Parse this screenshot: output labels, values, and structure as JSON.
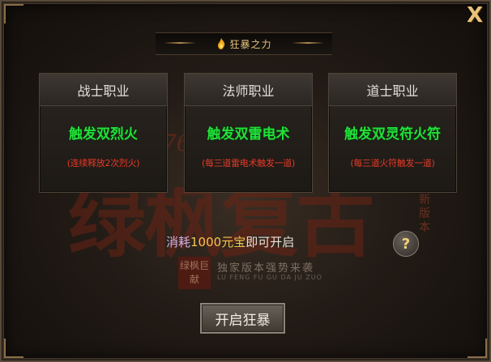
{
  "title": "狂暴之力",
  "close_label": "X",
  "cards": [
    {
      "class_name": "战士职业",
      "effect": "触发双烈火",
      "note": "(连续释放2次烈火)"
    },
    {
      "class_name": "法师职业",
      "effect": "触发双雷电术",
      "note": "(每三道雷电术触发一道)"
    },
    {
      "class_name": "道士职业",
      "effect": "触发双灵符火符",
      "note": "(每三道火符触发一道)"
    }
  ],
  "cost": {
    "prefix": "消耗",
    "amount": "1000元宝",
    "suffix": "即可开启"
  },
  "help_label": "?",
  "start_button": "开启狂暴",
  "watermark": {
    "big_text": "绿枫复古",
    "number": "176",
    "seal": "绿枫巨献",
    "tagline": "独家版本强势来袭",
    "pinyin": "LU FENG FU GU DA JU ZUO",
    "badge": "全新版本"
  },
  "colors": {
    "effect": "#22e03a",
    "note": "#e53a28",
    "amount": "#f4c44c",
    "title": "#e6c27a"
  },
  "icons": {
    "title": "flame-icon",
    "close": "close-icon",
    "help": "question-icon"
  }
}
